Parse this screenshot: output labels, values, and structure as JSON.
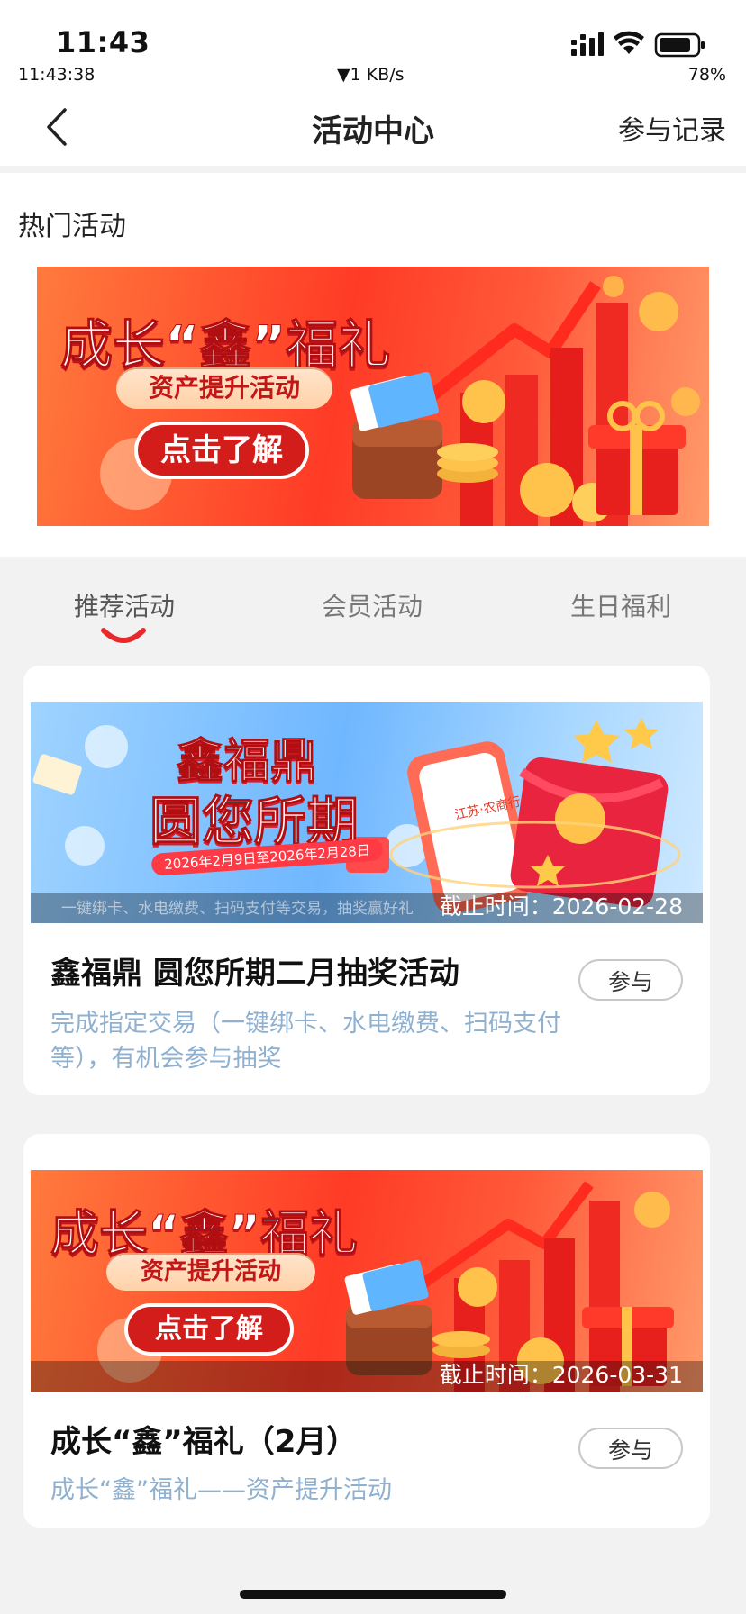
{
  "status_bar": {
    "time": "11:43",
    "time_seconds": "11:43:38",
    "network_speed": "▼1 KB/s",
    "battery_percent": "78%"
  },
  "nav": {
    "title": "活动中心",
    "right_label": "参与记录"
  },
  "hot_section": {
    "title": "热门活动",
    "banner": {
      "headline": "成长“鑫”福礼",
      "subtitle": "资产提升活动",
      "button": "点击了解"
    }
  },
  "tabs": [
    {
      "label": "推荐活动",
      "active": true
    },
    {
      "label": "会员活动",
      "active": false
    },
    {
      "label": "生日福利",
      "active": false
    }
  ],
  "activities": [
    {
      "banner_headline_1": "鑫福鼎",
      "banner_headline_2": "圆您所期",
      "banner_date": "2026年2月9日至2026年2月28日",
      "banner_caption": "一键绑卡、水电缴费、扫码支付等交易，抽奖赢好礼",
      "banner_phone_text": "江苏·农商行",
      "deadline": "截止时间：2026-02-28",
      "title": "鑫福鼎 圆您所期二月抽奖活动",
      "description": "完成指定交易（一键绑卡、水电缴费、扫码支付等），有机会参与抽奖",
      "join_label": "参与"
    },
    {
      "banner_headline": "成长“鑫”福礼",
      "banner_subtitle": "资产提升活动",
      "banner_button": "点击了解",
      "deadline": "截止时间：2026-03-31",
      "title": "成长“鑫”福礼（2月）",
      "description": "成长“鑫”福礼——资产提升活动",
      "join_label": "参与"
    }
  ],
  "colors": {
    "accent_red": "#e8282a",
    "desc_blue": "#8fb0cf",
    "tab_inactive": "#777777"
  }
}
